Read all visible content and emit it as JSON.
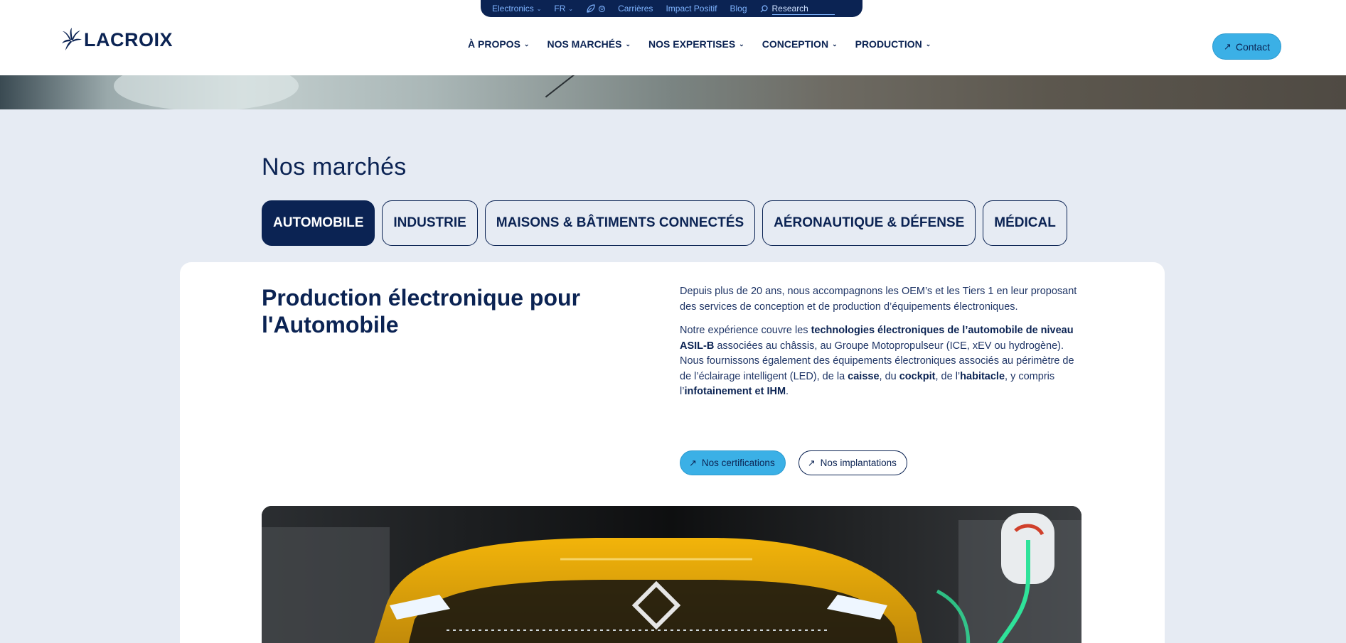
{
  "utility_bar": {
    "site_selector": "Electronics",
    "language": "FR",
    "eco_badge": "0",
    "links": [
      "Carrières",
      "Impact Positif",
      "Blog"
    ],
    "search_placeholder": "Research"
  },
  "header": {
    "logo_text": "LACROIX",
    "nav": [
      {
        "label": "À PROPOS"
      },
      {
        "label": "NOS MARCHÉS"
      },
      {
        "label": "NOS EXPERTISES"
      },
      {
        "label": "CONCEPTION"
      },
      {
        "label": "PRODUCTION"
      }
    ],
    "contact_label": "Contact"
  },
  "section": {
    "title": "Nos marchés",
    "tabs": [
      {
        "label": "AUTOMOBILE",
        "active": true
      },
      {
        "label": "INDUSTRIE",
        "active": false
      },
      {
        "label": "MAISONS & BÂTIMENTS CONNECTÉS",
        "active": false
      },
      {
        "label": "AÉRONAUTIQUE & DÉFENSE",
        "active": false
      },
      {
        "label": "MÉDICAL",
        "active": false
      }
    ]
  },
  "card": {
    "title": "Production électronique pour l'Automobile",
    "para1": "Depuis plus de 20 ans, nous accompagnons les OEM’s et les Tiers 1 en leur proposant des services de conception et de production d’équipements électroniques.",
    "para2": {
      "t1": "Notre expérience couvre les ",
      "b1": "technologies électroniques de l’automobile de niveau ASIL-B",
      "t2": " associées au châssis, au Groupe Motopropulseur (ICE, xEV  ou hydrogène)."
    },
    "para3": {
      "t1": "Nous fournissons également des équipements électroniques associés au périmètre de de l’éclairage intelligent (LED), de la ",
      "b1": "caisse",
      "t2": ", du ",
      "b2": "cockpit",
      "t3": ", de l’",
      "b3": "habitacle",
      "t4": ", y compris l’",
      "b4": "infotainement et IHM",
      "t5": "."
    },
    "buttons": {
      "certifications": "Nos certifications",
      "implantations": "Nos implantations"
    }
  },
  "colors": {
    "navy": "#0b2353",
    "accent": "#3bb0e6",
    "background": "#e6ebf3"
  }
}
